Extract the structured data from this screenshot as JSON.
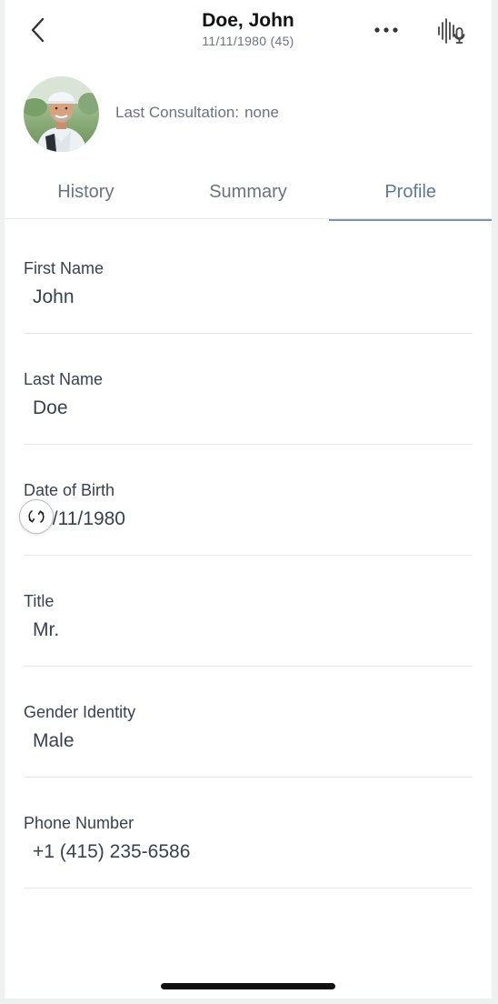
{
  "header": {
    "name": "Doe, John",
    "dob_age": "11/11/1980 (45)"
  },
  "icons": {
    "back": "chevron-left-icon",
    "more": "more-horizontal-icon",
    "voice": "voice-waveform-mic-icon",
    "sync": "refresh-icon"
  },
  "profile": {
    "last_consultation_label": "Last Consultation:",
    "last_consultation_value": "none"
  },
  "tabs": [
    {
      "label": "History",
      "active": false
    },
    {
      "label": "Summary",
      "active": false
    },
    {
      "label": "Profile",
      "active": true
    }
  ],
  "fields": [
    {
      "label": "First Name",
      "value": "John"
    },
    {
      "label": "Last Name",
      "value": "Doe"
    },
    {
      "label": "Date of Birth",
      "value": "11/11/1980"
    },
    {
      "label": "Title",
      "value": "Mr."
    },
    {
      "label": "Gender Identity",
      "value": "Male"
    },
    {
      "label": "Phone Number",
      "value": "+1 (415) 235-6586"
    }
  ],
  "colors": {
    "accent": "#5b7a99",
    "text": "#374151",
    "muted": "#6b7280"
  }
}
